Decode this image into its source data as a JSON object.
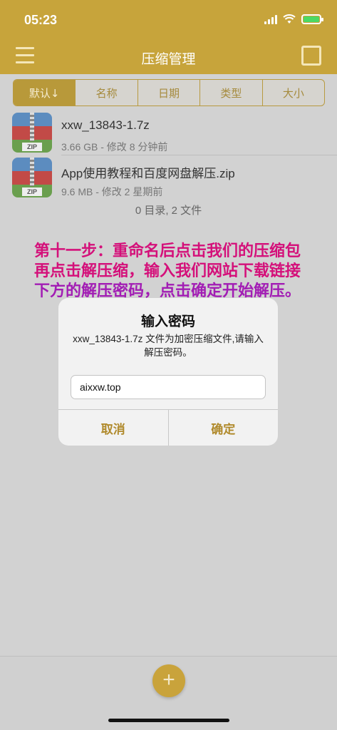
{
  "status": {
    "time": "05:23"
  },
  "nav": {
    "title": "压缩管理"
  },
  "sort_tabs": [
    "默认↓",
    "名称",
    "日期",
    "类型",
    "大小"
  ],
  "files": [
    {
      "name": "xxw_13843-1.7z",
      "meta": "3.66 GB - 修改 8 分钟前",
      "icon_label": "ZIP"
    },
    {
      "name": "App使用教程和百度网盘解压.zip",
      "meta": "9.6 MB - 修改 2 星期前",
      "icon_label": "ZIP"
    }
  ],
  "summary": "0 目录, 2 文件",
  "annotation": {
    "line1": "第十一步：重命名后点击我们的压缩包",
    "line2": "再点击解压缩，输入我们网站下载链接",
    "line3": "下方的解压密码，点击确定开始解压。"
  },
  "dialog": {
    "title": "输入密码",
    "message": "xxw_13843-1.7z 文件为加密压缩文件,请输入解压密码。",
    "input_value": "aixxw.top",
    "cancel_label": "取消",
    "confirm_label": "确定"
  },
  "fab_label": "+",
  "colors": {
    "accent": "#c7a43b",
    "annotation_red": "#d4107a",
    "annotation_purple": "#a21db4"
  }
}
